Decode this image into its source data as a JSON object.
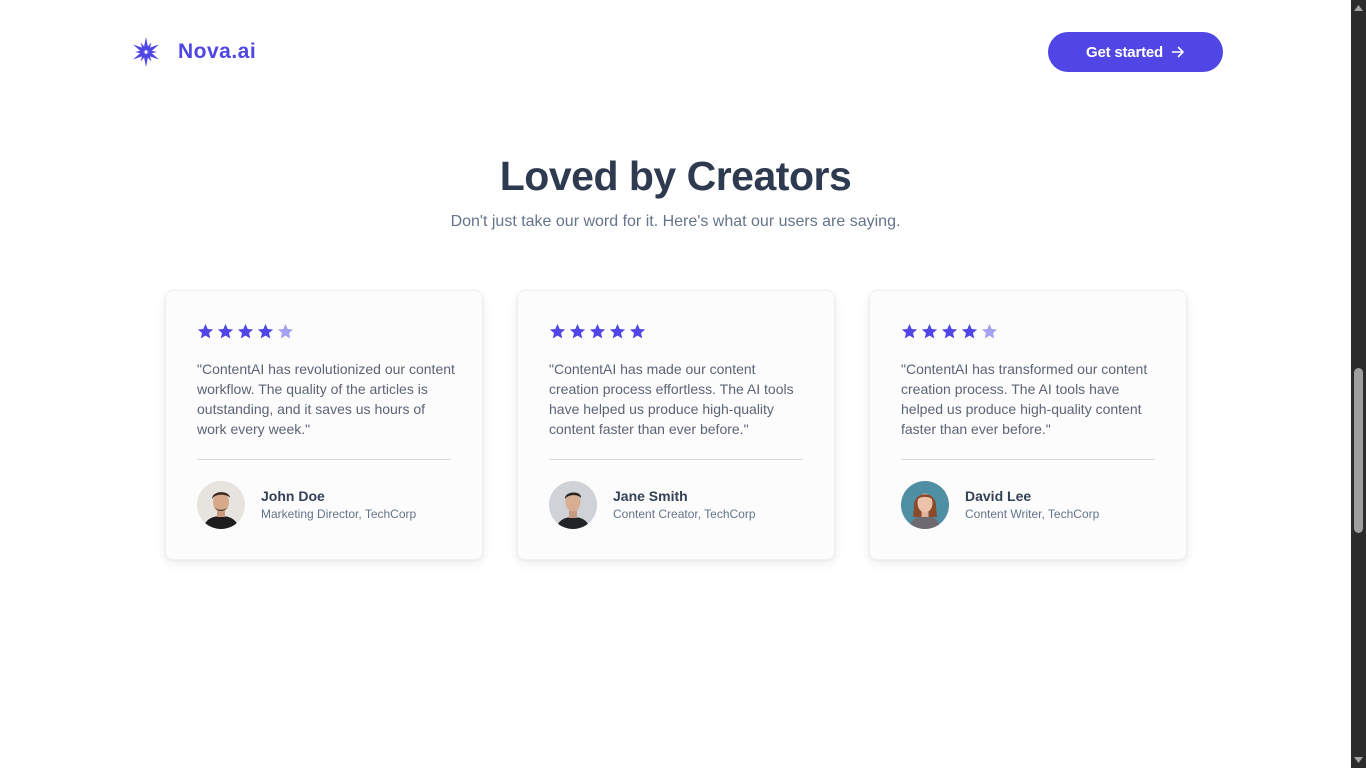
{
  "header": {
    "brand": "Nova.ai",
    "logo_icon": "star-burst-icon",
    "cta_label": "Get started",
    "cta_icon": "arrow-right-icon"
  },
  "section": {
    "title": "Loved by Creators",
    "subtitle": "Don't just take our word for it. Here's what our users are saying."
  },
  "testimonials": [
    {
      "rating": 4,
      "max_rating": 5,
      "quote": "\"ContentAI has revolutionized our content workflow. The quality of the articles is outstanding, and it saves us hours of work every week.\"",
      "name": "John Doe",
      "role": "Marketing Director, TechCorp"
    },
    {
      "rating": 5,
      "max_rating": 5,
      "quote": "\"ContentAI has made our content creation process effortless. The AI tools have helped us produce high-quality content faster than ever before.\"",
      "name": "Jane Smith",
      "role": "Content Creator, TechCorp"
    },
    {
      "rating": 4,
      "max_rating": 5,
      "quote": "\"ContentAI has transformed our content creation process. The AI tools have helped us produce high-quality content faster than ever before.\"",
      "name": "David Lee",
      "role": "Content Writer, TechCorp"
    }
  ],
  "colors": {
    "accent": "#4f46e5",
    "star_filled": "#4f46e5",
    "star_empty": "#a5a0f0",
    "heading": "#2d3a4f",
    "body_text": "#5b6475"
  }
}
